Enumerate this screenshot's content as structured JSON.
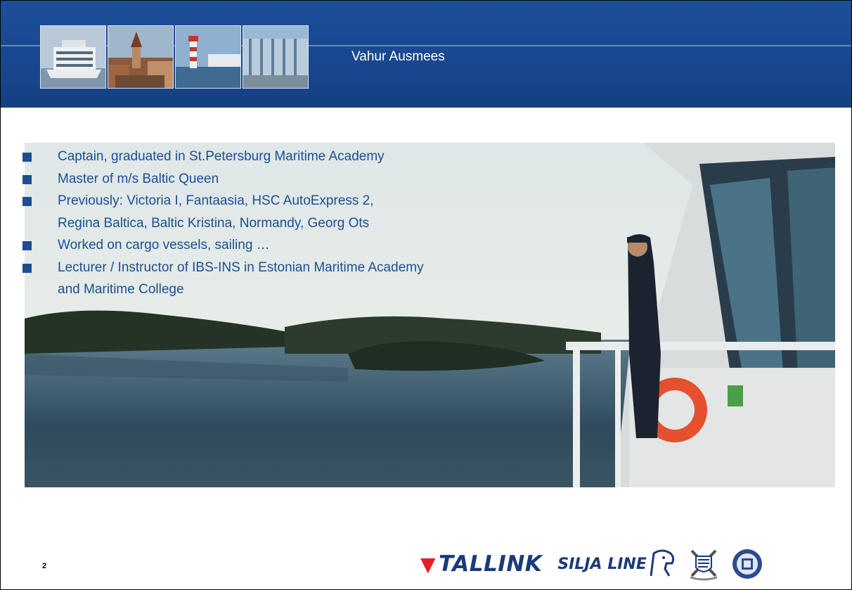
{
  "header": {
    "speaker_name": "Vahur Ausmees",
    "thumbnails": [
      "ship-photo",
      "old-town-photo",
      "lighthouse-photo",
      "terminal-photo"
    ]
  },
  "bullets": [
    {
      "lines": [
        "Captain, graduated in St.Petersburg Maritime Academy"
      ]
    },
    {
      "lines": [
        "Master of m/s Baltic Queen"
      ]
    },
    {
      "lines": [
        "Previously: Victoria I, Fantaasia, HSC AutoExpress 2,",
        "Regina Baltica, Baltic Kristina, Normandy, Georg Ots"
      ]
    },
    {
      "lines": [
        "Worked on cargo vessels, sailing …"
      ]
    },
    {
      "lines": [
        "Lecturer / Instructor of IBS-INS in Estonian Maritime Academy",
        "and Maritime College"
      ]
    }
  ],
  "footer": {
    "page_number": "2",
    "logo_tallink": "TALLINK",
    "logo_silja": "SILJA LINE"
  },
  "colors": {
    "header_blue": "#1c4f99",
    "bullet_text": "#1b4f94",
    "tallink_red": "#e41f2a"
  }
}
